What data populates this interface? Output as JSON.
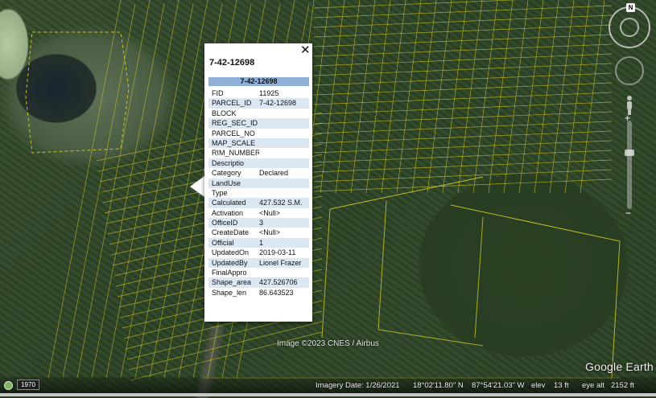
{
  "popup": {
    "title": "7-42-12698",
    "table_header": "7-42-12698",
    "close_icon": "close-icon",
    "rows": [
      {
        "key": "FID",
        "value": "11925"
      },
      {
        "key": "PARCEL_ID",
        "value": "7-42-12698"
      },
      {
        "key": "BLOCK",
        "value": ""
      },
      {
        "key": "REG_SEC_ID",
        "value": ""
      },
      {
        "key": "PARCEL_NO",
        "value": ""
      },
      {
        "key": "MAP_SCALE",
        "value": ""
      },
      {
        "key": "RIM_NUMBER",
        "value": ""
      },
      {
        "key": "Descriptio",
        "value": ""
      },
      {
        "key": "Category",
        "value": "Declared"
      },
      {
        "key": "LandUse",
        "value": ""
      },
      {
        "key": "Type",
        "value": ""
      },
      {
        "key": "Calculated",
        "value": "427.532 S.M."
      },
      {
        "key": "Activation",
        "value": "<Null>"
      },
      {
        "key": "OfficeID",
        "value": "3"
      },
      {
        "key": "CreateDate",
        "value": "<Null>"
      },
      {
        "key": "Official",
        "value": "1"
      },
      {
        "key": "UpdatedOn",
        "value": "2019-03-11"
      },
      {
        "key": "UpdatedBy",
        "value": "Lionel Frazer"
      },
      {
        "key": "FinalAppro",
        "value": ""
      },
      {
        "key": "Shape_area",
        "value": "427.526706"
      },
      {
        "key": "Shape_len",
        "value": "86.643523"
      }
    ]
  },
  "navigation": {
    "north_label": "N"
  },
  "credit": "Image ©2023 CNES / Airbus",
  "brand": "Google Earth",
  "statusbar": {
    "year": "1970",
    "imagery_date": "Imagery Date: 1/26/2021",
    "latitude": "18°02'11.80\" N",
    "longitude": "87°54'21.03\" W",
    "elev_label": "elev",
    "elev_value": "13 ft",
    "eye_alt_label": "eye alt",
    "eye_alt_value": "2152 ft"
  },
  "colors": {
    "parcel_line": "#e6dc2a",
    "popup_header": "#8fb0d8",
    "popup_alt_row": "#dce7f4"
  }
}
